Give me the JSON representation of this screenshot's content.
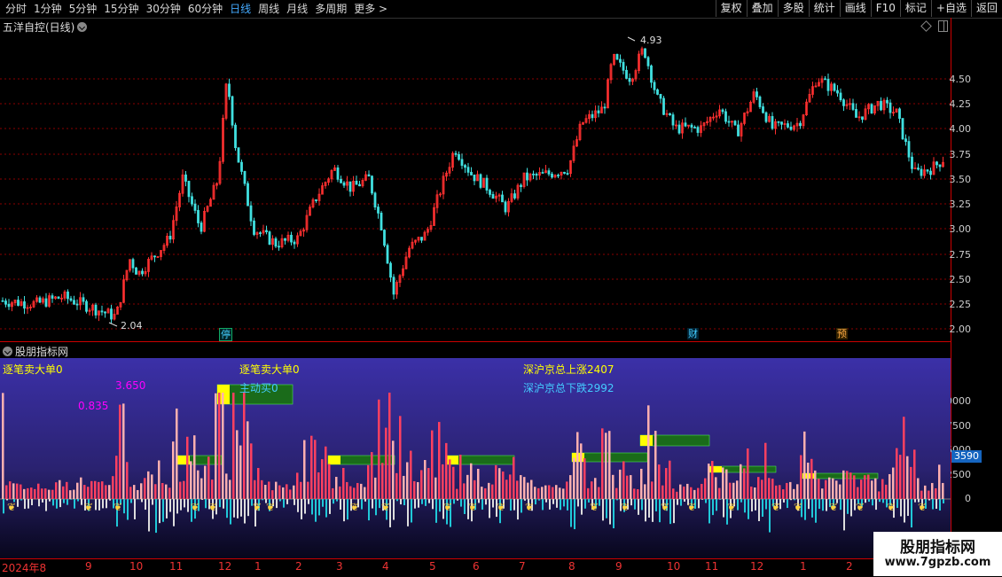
{
  "toolbar": {
    "tabs": [
      "分时",
      "1分钟",
      "5分钟",
      "15分钟",
      "30分钟",
      "60分钟",
      "日线",
      "周线",
      "月线",
      "多周期",
      "更多 >"
    ],
    "active_tab": "日线",
    "right_buttons": [
      "复权",
      "叠加",
      "多股",
      "统计",
      "画线",
      "F10",
      "标记",
      "+自选",
      "返回"
    ]
  },
  "chart": {
    "stock_title": "五洋自控(日线)",
    "high_label": "4.93",
    "low_label": "2.04",
    "price_axis": [
      "4.50",
      "4.25",
      "4.00",
      "3.75",
      "3.50",
      "3.25",
      "3.00",
      "2.75",
      "2.50",
      "2.25",
      "2.00"
    ],
    "markers": [
      {
        "text": "停",
        "color": "#4cf"
      },
      {
        "text": "财",
        "color": "#4cf"
      },
      {
        "text": "预",
        "color": "#fa4"
      }
    ]
  },
  "indicator": {
    "title": "股朋指标网",
    "sell_big": "逐笔卖大单0",
    "sell_big2": "逐笔卖大单0",
    "buy_active": "主动买0",
    "val1": "3.650",
    "val2": "0.835",
    "up_total": "深沪京总上涨2407",
    "down_total": "深沪京总下跌2992",
    "axis": [
      "10000",
      "7500",
      "5000",
      "2500",
      "0"
    ],
    "badge": "3590"
  },
  "xaxis": {
    "labels": [
      "2024年8",
      "9",
      "10",
      "11",
      "12",
      "1",
      "2",
      "3",
      "4",
      "5",
      "6",
      "7",
      "8",
      "9",
      "10",
      "11",
      "12",
      "1",
      "2"
    ]
  },
  "watermark": {
    "line1": "股朋指标网",
    "line2": "www.7gpzb.com"
  },
  "colors": {
    "up": "#ff3030",
    "down": "#40e0e0",
    "grid": "#8b0000",
    "indicator_bg": "#3a2f9a"
  }
}
